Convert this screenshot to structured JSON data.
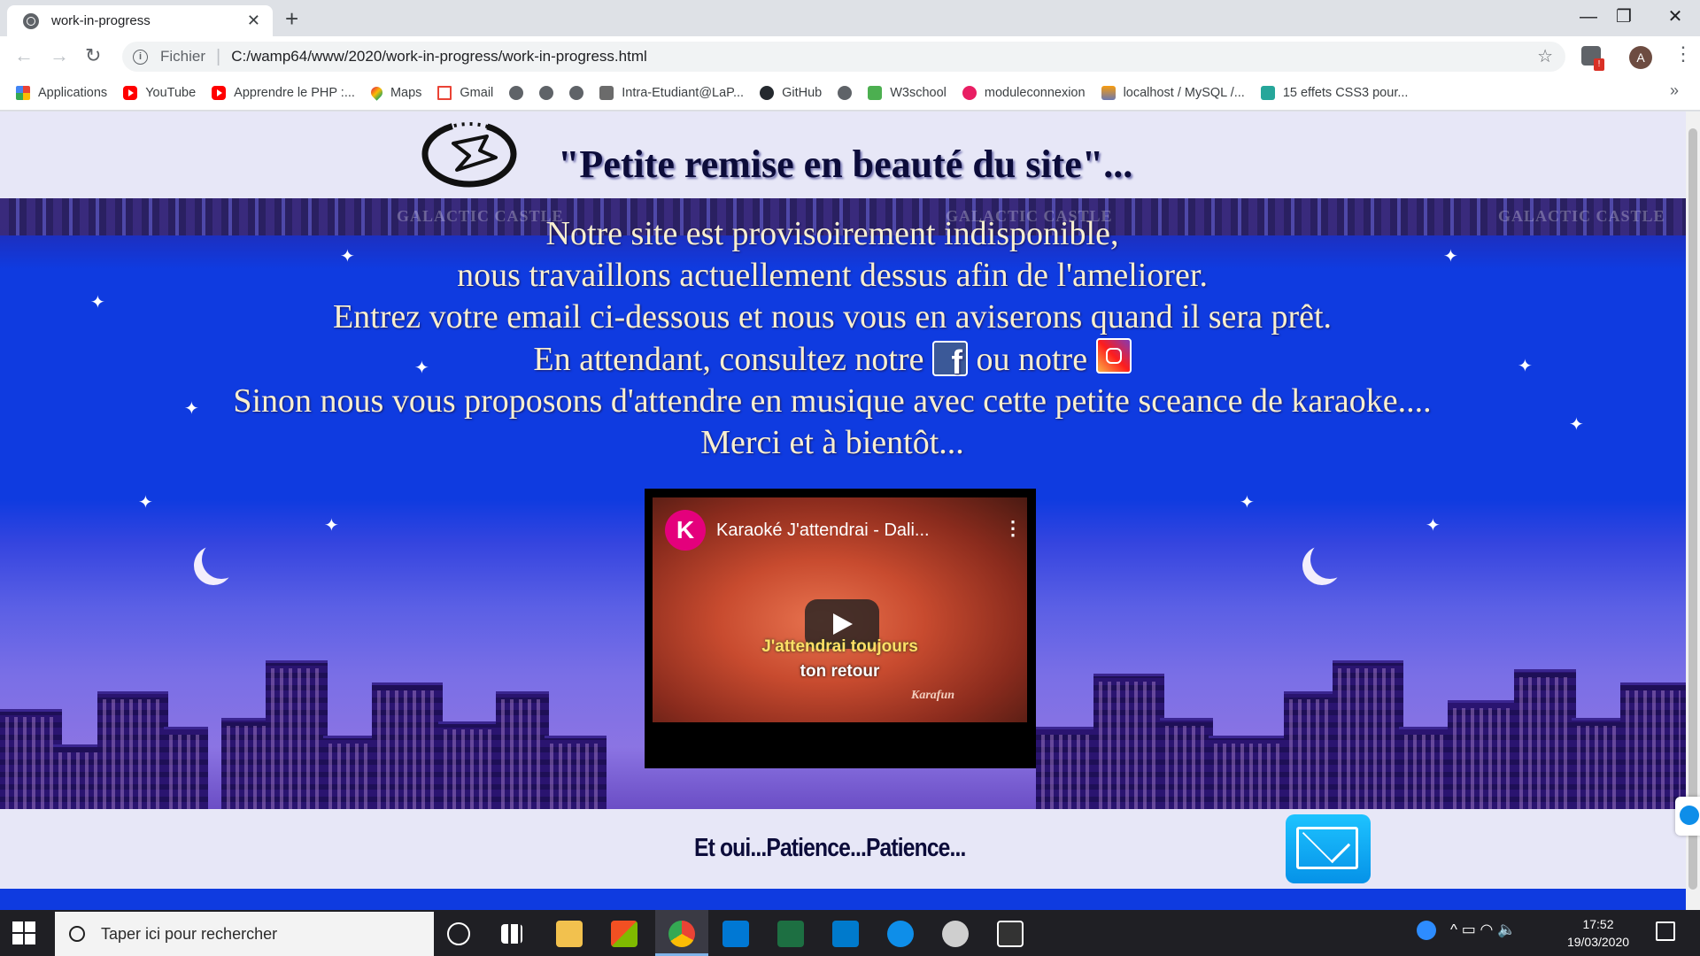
{
  "browser": {
    "tab": {
      "title": "work-in-progress",
      "close": "✕"
    },
    "new_tab": "+",
    "window_controls": {
      "minimize": "—",
      "maximize": "❐",
      "close": "✕"
    },
    "nav": {
      "back": "←",
      "forward": "→",
      "reload": "↻"
    },
    "address": {
      "scheme_label": "Fichier",
      "url": "C:/wamp64/www/2020/work-in-progress/work-in-progress.html",
      "star": "☆"
    },
    "avatar_letter": "A",
    "extension_badge": "!",
    "menu": "⋮",
    "bookmarks": [
      {
        "label": "Applications",
        "icon": "apps"
      },
      {
        "label": "YouTube",
        "icon": "yt"
      },
      {
        "label": "Apprendre le PHP :...",
        "icon": "yt"
      },
      {
        "label": "Maps",
        "icon": "maps"
      },
      {
        "label": "Gmail",
        "icon": "gmail"
      },
      {
        "label": "",
        "icon": "globe"
      },
      {
        "label": "",
        "icon": "globe"
      },
      {
        "label": "",
        "icon": "globe"
      },
      {
        "label": "Intra-Etudiant@LaP...",
        "icon": "intra"
      },
      {
        "label": "GitHub",
        "icon": "gh"
      },
      {
        "label": "",
        "icon": "globe"
      },
      {
        "label": "W3school",
        "icon": "w3"
      },
      {
        "label": "moduleconnexion",
        "icon": "mod"
      },
      {
        "label": "localhost / MySQL /...",
        "icon": "pma"
      },
      {
        "label": "15 effets CSS3 pour...",
        "icon": "css3"
      }
    ],
    "bookmarks_more": "»"
  },
  "page": {
    "headline": "\"Petite remise en beauté du site\"...",
    "message": {
      "line1": "Notre site est provisoirement indisponible,",
      "line2": "nous travaillons actuellement dessus afin de l'ameliorer.",
      "line3": "Entrez votre email ci-dessous et nous vous en aviserons quand il sera prêt.",
      "line4_a": "En attendant, consultez notre",
      "line4_b": "ou notre",
      "line5": "Sinon nous vous proposons d'attendre en musique avec cette petite sceance de karaoke....",
      "line6": "Merci et à bientôt..."
    },
    "facebook_glyph": "f",
    "watermark": "GALACTIC CASTLE",
    "video": {
      "channel_letter": "K",
      "title": "Karaoké J'attendrai - Dali...",
      "menu": "⋮",
      "lyric_line1": "J'attendrai toujours",
      "lyric_line2": "ton retour",
      "brand": "Karafun"
    },
    "footer_text": "Et oui...Patience...Patience..."
  },
  "taskbar": {
    "search_placeholder": "Taper ici pour rechercher",
    "tray_glyphs": "^ ▭ ◠ 🔈",
    "time": "17:52",
    "date": "19/03/2020"
  }
}
